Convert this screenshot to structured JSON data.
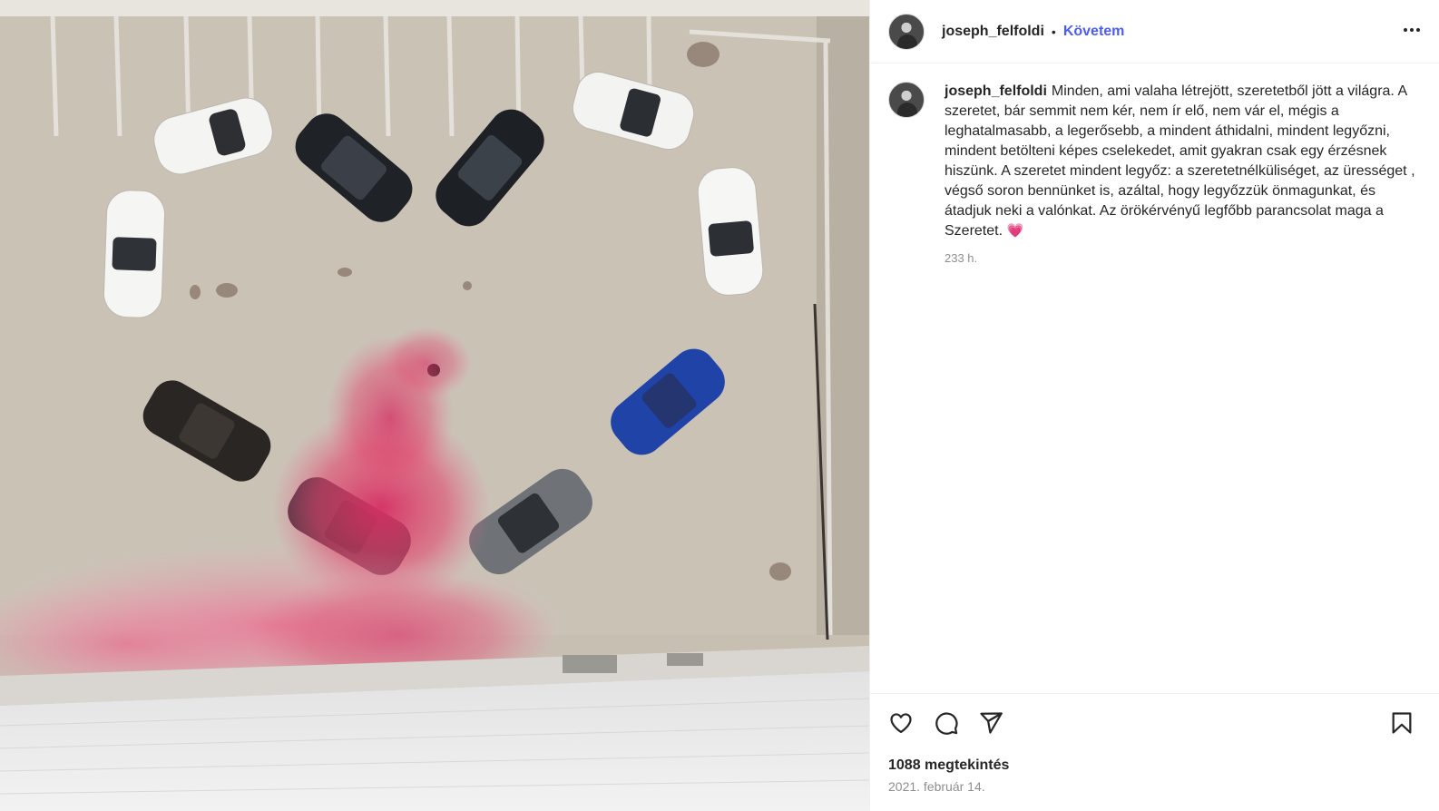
{
  "post": {
    "username": "joseph_felfoldi",
    "separator": "•",
    "follow_label": "Követem",
    "caption_user": "joseph_felfoldi",
    "caption_text": "Minden, ami valaha létrejött, szeretetből jött a világra. A szeretet, bár semmit nem kér, nem ír elő, nem vár el, mégis a leghatalmasabb, a legerősebb, a mindent áthidalni, mindent legyőzni, mindent betölteni képes cselekedet, amit gyakran csak egy érzésnek hiszünk. A szeretet mindent legyőz: a szeretetnélküliséget, az ürességet , végső soron bennünket is, azáltal, hogy legyőzzük önmagunkat, és átadjuk neki a valónkat. Az örökérvényű legfőbb parancsolat maga a Szeretet.",
    "caption_emoji": "💗",
    "time_ago": "233 h.",
    "views": "1088 megtekintés",
    "date": "2021. február 14."
  },
  "icons": {
    "more": "more-options-icon",
    "like": "heart-icon",
    "comment": "comment-icon",
    "share": "share-icon",
    "save": "bookmark-icon"
  },
  "colors": {
    "follow": "#4a5df0",
    "muted": "#8e8e8e",
    "text": "#262626",
    "smoke": "#e0486f"
  }
}
